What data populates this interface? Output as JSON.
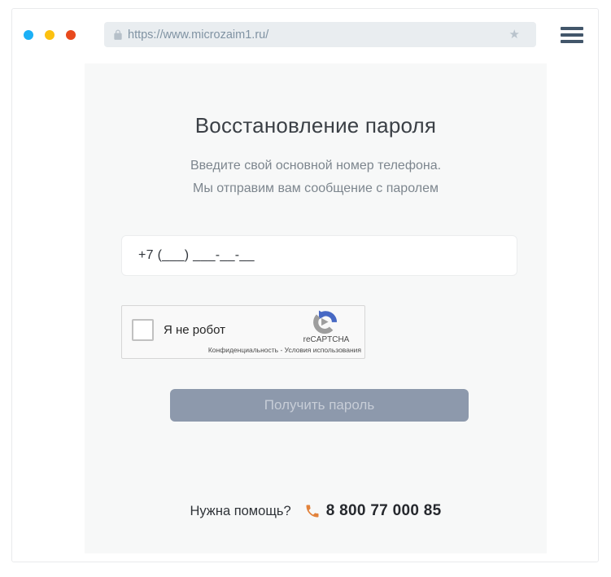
{
  "browser": {
    "url": "https://www.microzaim1.ru/",
    "traffic_lights": {
      "blue": "#1cb0f6",
      "yellow": "#fcc110",
      "red": "#e8491d"
    }
  },
  "recovery": {
    "title": "Восстановление пароля",
    "subtitle_line1": "Введите свой основной номер телефона.",
    "subtitle_line2": "Мы отправим вам сообщение с паролем",
    "phone_mask": "+7 (___) ___-__-__",
    "submit_label": "Получить пароль"
  },
  "captcha": {
    "checkbox_label": "Я не робот",
    "brand": "reCAPTCHA",
    "privacy_label": "Конфиденциальность",
    "separator": " - ",
    "terms_label": "Условия использования"
  },
  "help": {
    "question": "Нужна помощь?",
    "phone_number": "8 800 77 000 85"
  },
  "colors": {
    "content_bg": "#f7f8f8",
    "button_bg": "#8d99ac",
    "accent_orange": "#e2823b",
    "lock_gray": "#b6c0c9",
    "logo_blue": "#4769c4",
    "logo_gray": "#9d9d9d"
  }
}
